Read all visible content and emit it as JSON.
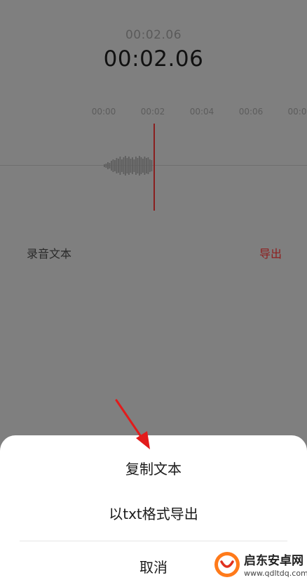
{
  "recorder": {
    "elapsed_small": "00:02.06",
    "elapsed_large": "00:02.06",
    "timeline_ticks": [
      "00:00",
      "00:02",
      "00:04",
      "00:06",
      "00:0"
    ],
    "section_label": "录音文本",
    "export_label": "导出"
  },
  "sheet": {
    "copy_text": "复制文本",
    "export_txt": "以txt格式导出",
    "cancel": "取消"
  },
  "watermark": {
    "title": "启东安卓网",
    "url": "www.qdltdq.com"
  },
  "colors": {
    "accent": "#c0392b",
    "overlay": "#7f7f7f",
    "sheet_bg": "#ffffff"
  }
}
